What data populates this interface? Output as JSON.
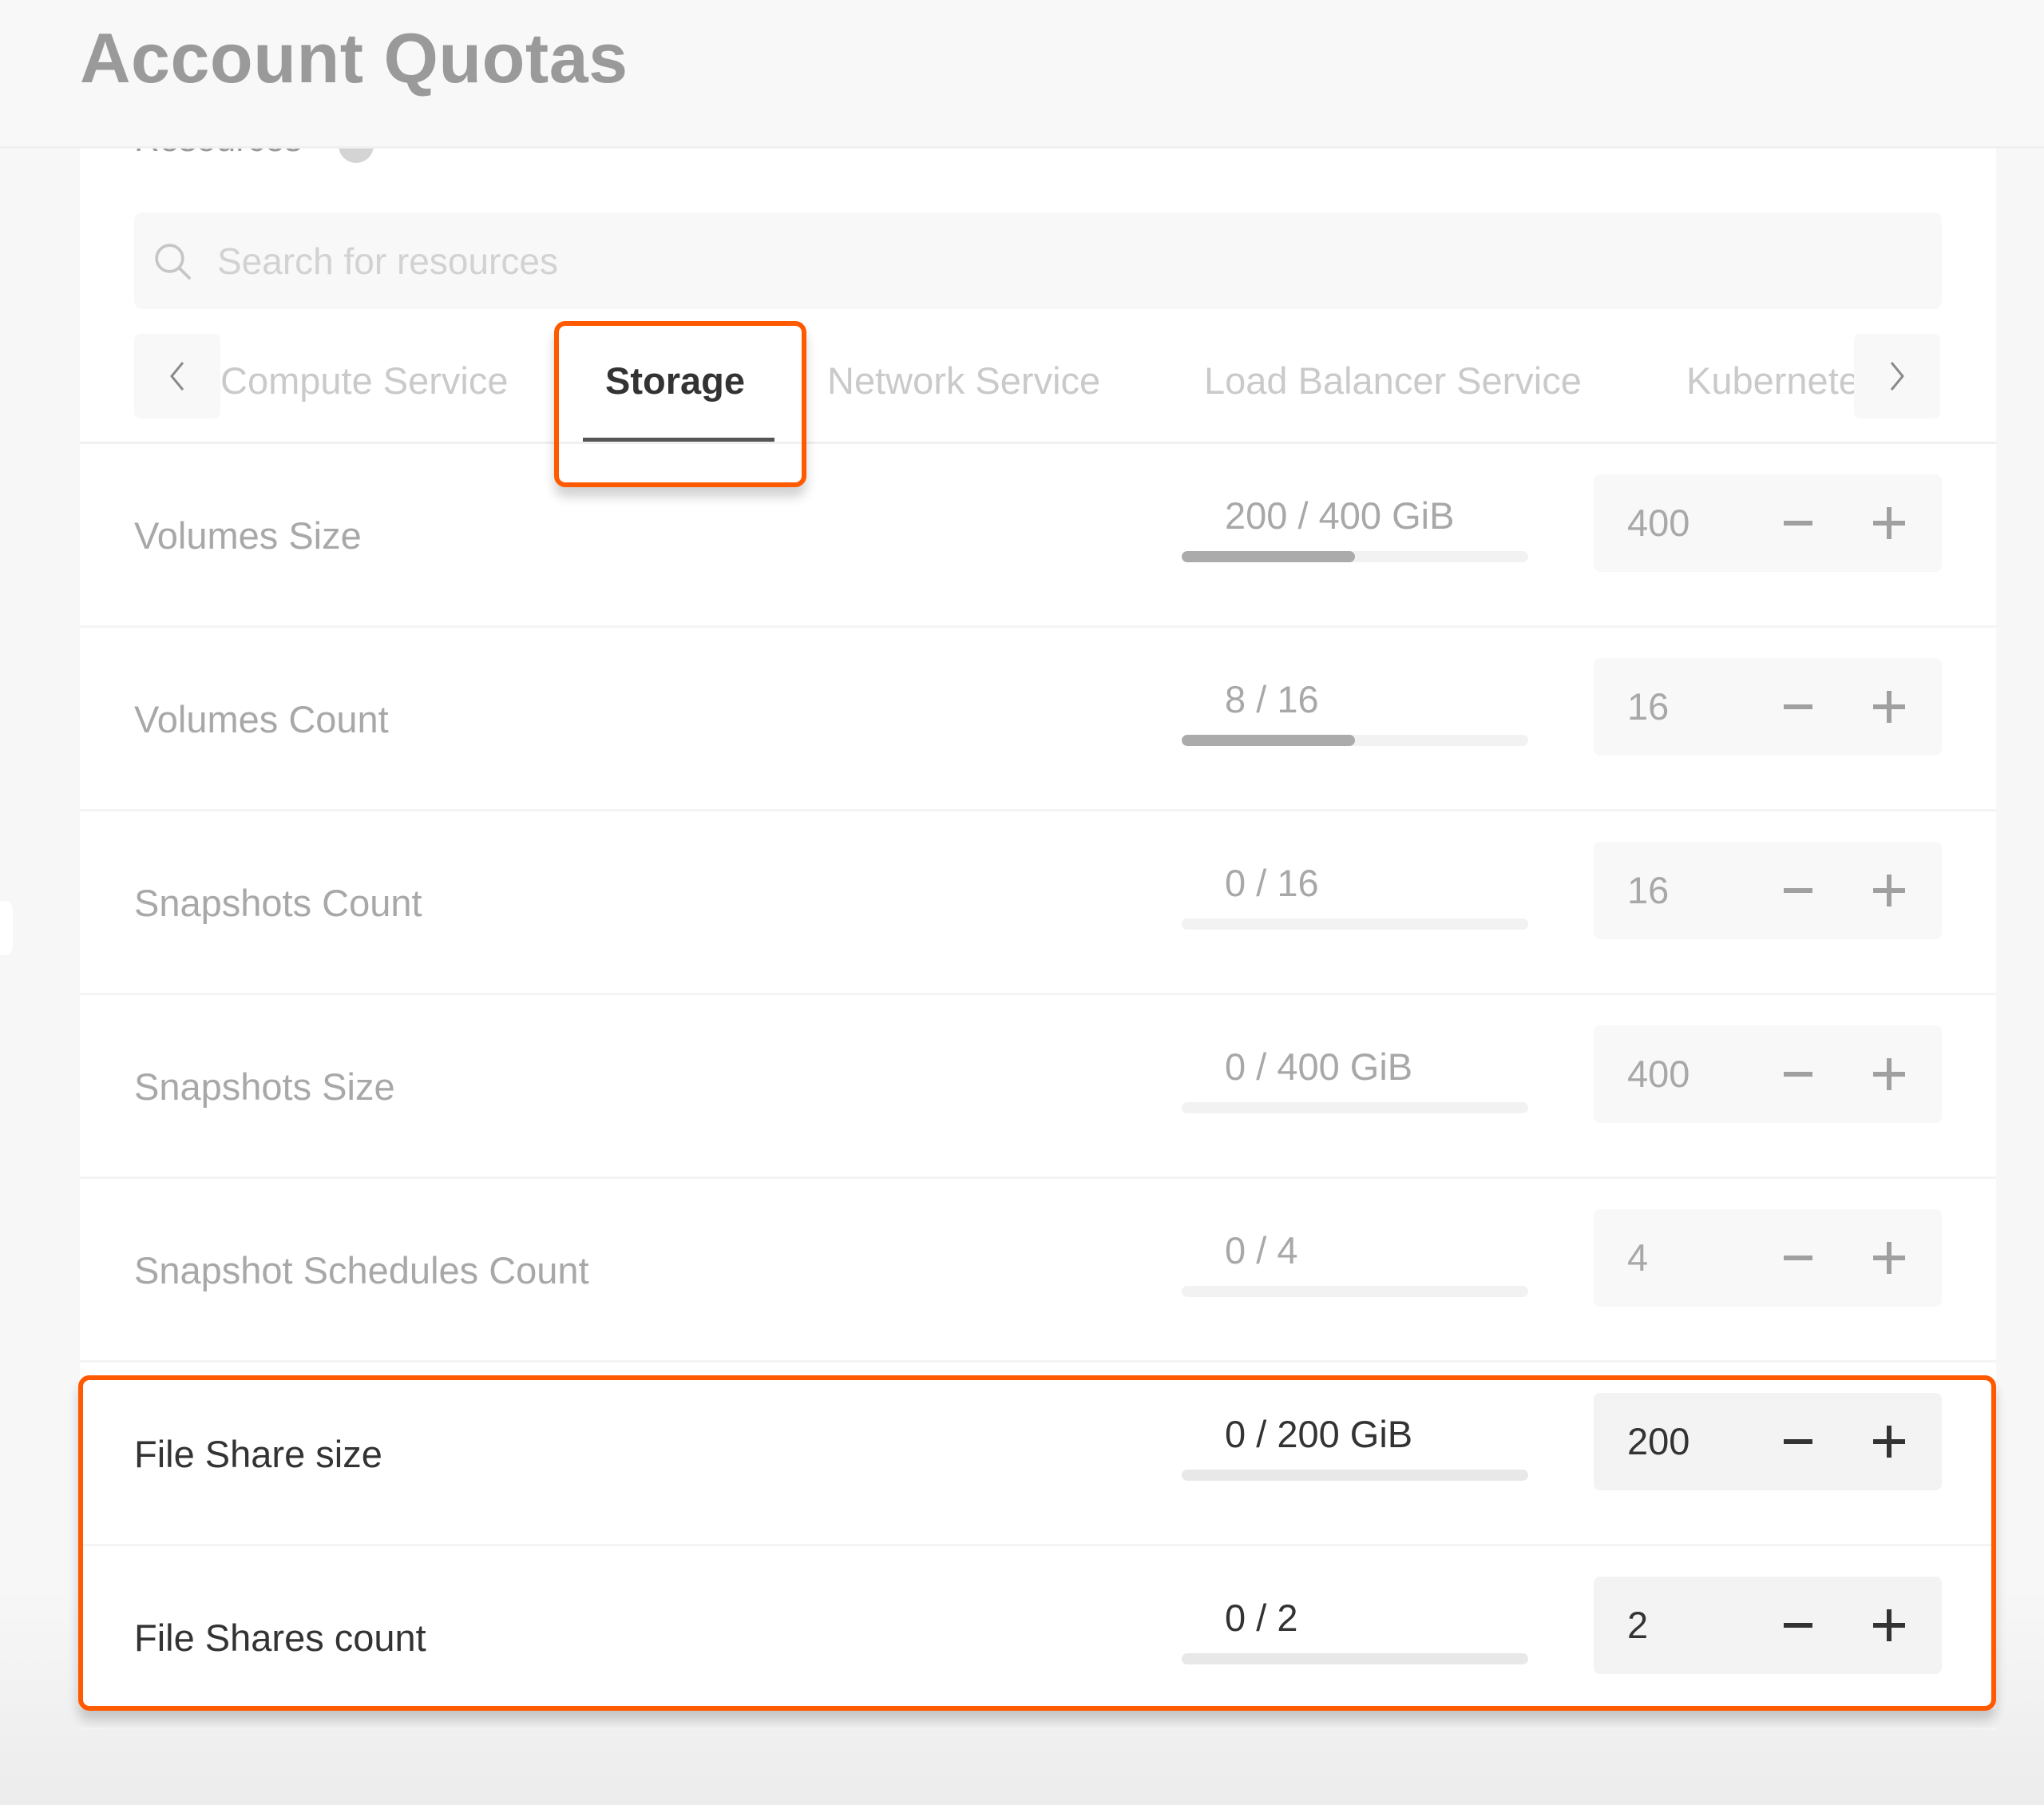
{
  "header": {
    "title": "Account Quotas"
  },
  "section": {
    "label": "Resources"
  },
  "search": {
    "placeholder": "Search for resources",
    "value": ""
  },
  "tabs": [
    {
      "label": "Compute Service",
      "active": false
    },
    {
      "label": "Storage",
      "active": true
    },
    {
      "label": "Network Service",
      "active": false
    },
    {
      "label": "Load Balancer Service",
      "active": false
    },
    {
      "label": "Kubernetes",
      "active": false
    }
  ],
  "rows": [
    {
      "label": "Volumes Size",
      "usage": "200 / 400 GiB",
      "used": 200,
      "limit": 400,
      "value": "400",
      "highlighted": false
    },
    {
      "label": "Volumes Count",
      "usage": "8 / 16",
      "used": 8,
      "limit": 16,
      "value": "16",
      "highlighted": false
    },
    {
      "label": "Snapshots Count",
      "usage": "0 / 16",
      "used": 0,
      "limit": 16,
      "value": "16",
      "highlighted": false
    },
    {
      "label": "Snapshots Size",
      "usage": "0 / 400 GiB",
      "used": 0,
      "limit": 400,
      "value": "400",
      "highlighted": false
    },
    {
      "label": "Snapshot Schedules Count",
      "usage": "0 / 4",
      "used": 0,
      "limit": 4,
      "value": "4",
      "highlighted": false
    },
    {
      "label": "File Share size",
      "usage": "0 / 200 GiB",
      "used": 0,
      "limit": 200,
      "value": "200",
      "highlighted": true
    },
    {
      "label": "File Shares count",
      "usage": "0 / 2",
      "used": 0,
      "limit": 2,
      "value": "2",
      "highlighted": true
    }
  ],
  "colors": {
    "highlight": "#ff5a00",
    "muted_text": "#a8a8a8",
    "active_text": "#333333",
    "bar_fill": "#ababab"
  }
}
